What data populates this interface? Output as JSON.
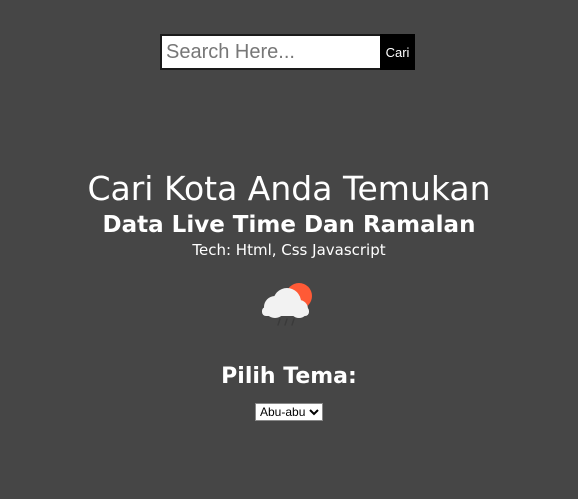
{
  "search": {
    "placeholder": "Search Here...",
    "value": "",
    "button_label": "Cari"
  },
  "hero": {
    "title": "Cari Kota Anda Temukan",
    "subtitle": "Data Live Time Dan Ramalan",
    "tech": "Tech: Html, Css Javascript"
  },
  "weather_icon": {
    "name": "cloud-sun-icon",
    "sun_color": "#ff5a36",
    "cloud_color": "#f2f2f2"
  },
  "theme": {
    "label": "Pilih Tema:",
    "selected": "Abu-abu",
    "options": [
      "Abu-abu"
    ]
  },
  "colors": {
    "background": "#464646",
    "text": "#ffffff",
    "search_button": "#000000"
  }
}
